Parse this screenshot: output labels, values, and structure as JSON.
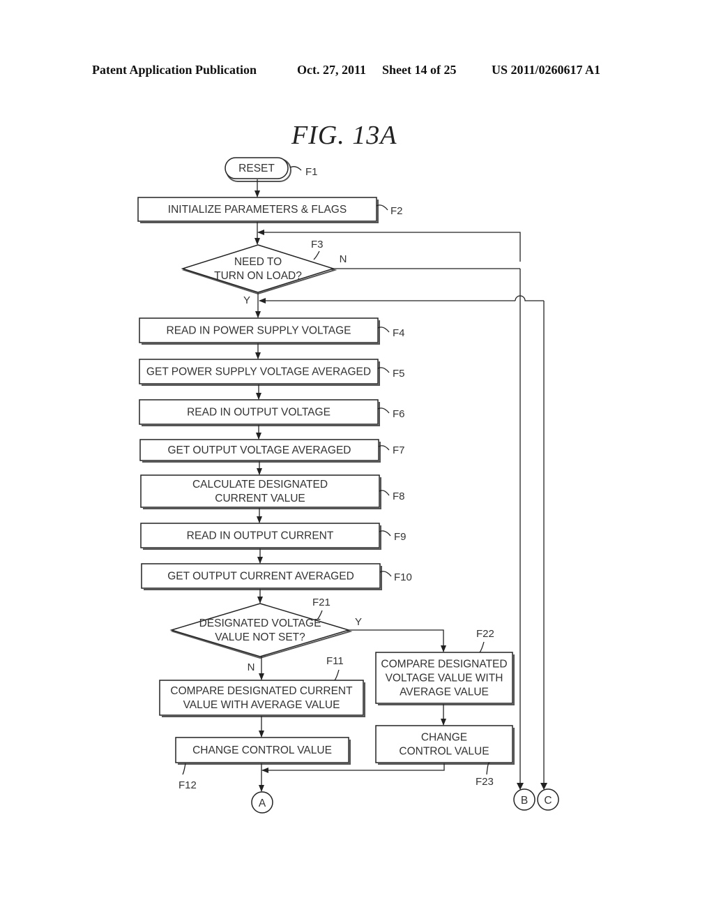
{
  "header": {
    "publication": "Patent Application Publication",
    "date": "Oct. 27, 2011",
    "sheet": "Sheet 14 of 25",
    "number": "US 2011/0260617 A1"
  },
  "figure_title": "FIG. 13A",
  "steps": {
    "F1": {
      "ref": "F1",
      "lines": [
        "RESET"
      ]
    },
    "F2": {
      "ref": "F2",
      "lines": [
        "INITIALIZE PARAMETERS & FLAGS"
      ]
    },
    "F3": {
      "ref": "F3",
      "lines": [
        "NEED TO",
        "TURN ON LOAD?"
      ]
    },
    "F4": {
      "ref": "F4",
      "lines": [
        "READ IN POWER SUPPLY VOLTAGE"
      ]
    },
    "F5": {
      "ref": "F5",
      "lines": [
        "GET POWER SUPPLY VOLTAGE AVERAGED"
      ]
    },
    "F6": {
      "ref": "F6",
      "lines": [
        "READ IN OUTPUT VOLTAGE"
      ]
    },
    "F7": {
      "ref": "F7",
      "lines": [
        "GET OUTPUT VOLTAGE AVERAGED"
      ]
    },
    "F8": {
      "ref": "F8",
      "lines": [
        "CALCULATE DESIGNATED",
        "CURRENT  VALUE"
      ]
    },
    "F9": {
      "ref": "F9",
      "lines": [
        "READ IN OUTPUT CURRENT"
      ]
    },
    "F10": {
      "ref": "F10",
      "lines": [
        "GET OUTPUT CURRENT AVERAGED"
      ]
    },
    "F21": {
      "ref": "F21",
      "lines": [
        "DESIGNATED VOLTAGE",
        "VALUE NOT SET?"
      ]
    },
    "F11": {
      "ref": "F11",
      "lines": [
        "COMPARE DESIGNATED CURRENT",
        "VALUE WITH AVERAGE VALUE"
      ]
    },
    "F12": {
      "ref": "F12",
      "lines": [
        "CHANGE CONTROL VALUE"
      ]
    },
    "F22": {
      "ref": "F22",
      "lines": [
        "COMPARE DESIGNATED",
        "VOLTAGE VALUE WITH",
        "AVERAGE VALUE"
      ]
    },
    "F23": {
      "ref": "F23",
      "lines": [
        "CHANGE",
        "CONTROL VALUE"
      ]
    }
  },
  "branch_labels": {
    "F3_no": "N",
    "F3_yes": "Y",
    "F21_yes": "Y",
    "F21_no": "N"
  },
  "connectors": [
    "A",
    "B",
    "C"
  ]
}
